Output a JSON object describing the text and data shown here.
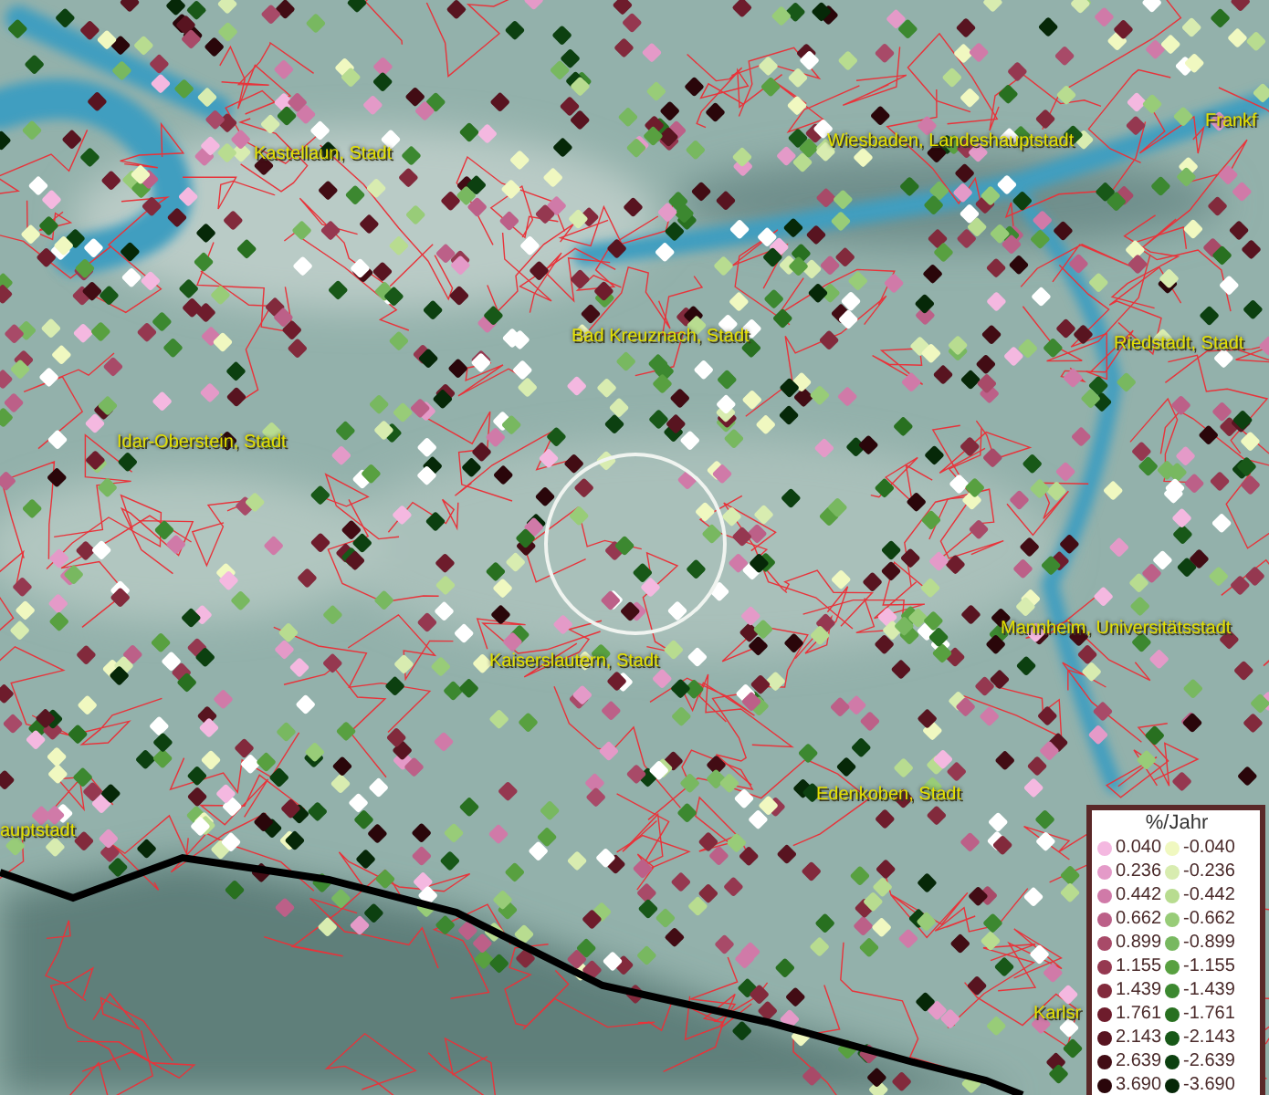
{
  "place_labels": [
    {
      "text": "Kastellaun, Stadt"
    },
    {
      "text": "Wiesbaden, Landeshauptstadt"
    },
    {
      "text": "Frankf"
    },
    {
      "text": "Bad Kreuznach, Stadt"
    },
    {
      "text": "Riedstadt, Stadt"
    },
    {
      "text": "Idar-Oberstein, Stadt"
    },
    {
      "text": "Kaiserslautern, Stadt"
    },
    {
      "text": "Mannheim, Universitätsstadt"
    },
    {
      "text": "Edenkoben, Stadt"
    },
    {
      "text": "auptstadt"
    },
    {
      "text": "Karlsr"
    }
  ],
  "legend": {
    "title": "%/Jahr",
    "items": [
      {
        "label": "0.040",
        "color": "#f4b8e0"
      },
      {
        "label": "0.236",
        "color": "#e49ac8"
      },
      {
        "label": "0.442",
        "color": "#d07aa8"
      },
      {
        "label": "0.662",
        "color": "#bc6088"
      },
      {
        "label": "0.899",
        "color": "#a84a68"
      },
      {
        "label": "1.155",
        "color": "#953850"
      },
      {
        "label": "1.439",
        "color": "#822a3c"
      },
      {
        "label": "1.761",
        "color": "#6e1c2c"
      },
      {
        "label": "2.143",
        "color": "#581420"
      },
      {
        "label": "2.639",
        "color": "#420c14"
      },
      {
        "label": "3.690",
        "color": "#2a060a"
      },
      {
        "label": "-0.040",
        "color": "#f0f8c0"
      },
      {
        "label": "-0.236",
        "color": "#d8ecb0"
      },
      {
        "label": "-0.442",
        "color": "#b8dc90"
      },
      {
        "label": "-0.662",
        "color": "#98cc78"
      },
      {
        "label": "-0.899",
        "color": "#78b860"
      },
      {
        "label": "-1.155",
        "color": "#58a040"
      },
      {
        "label": "-1.439",
        "color": "#3c8830"
      },
      {
        "label": "-1.761",
        "color": "#287020"
      },
      {
        "label": "-2.143",
        "color": "#185818"
      },
      {
        "label": "-2.639",
        "color": "#0c4010"
      },
      {
        "label": "-3.690",
        "color": "#062808"
      }
    ]
  }
}
